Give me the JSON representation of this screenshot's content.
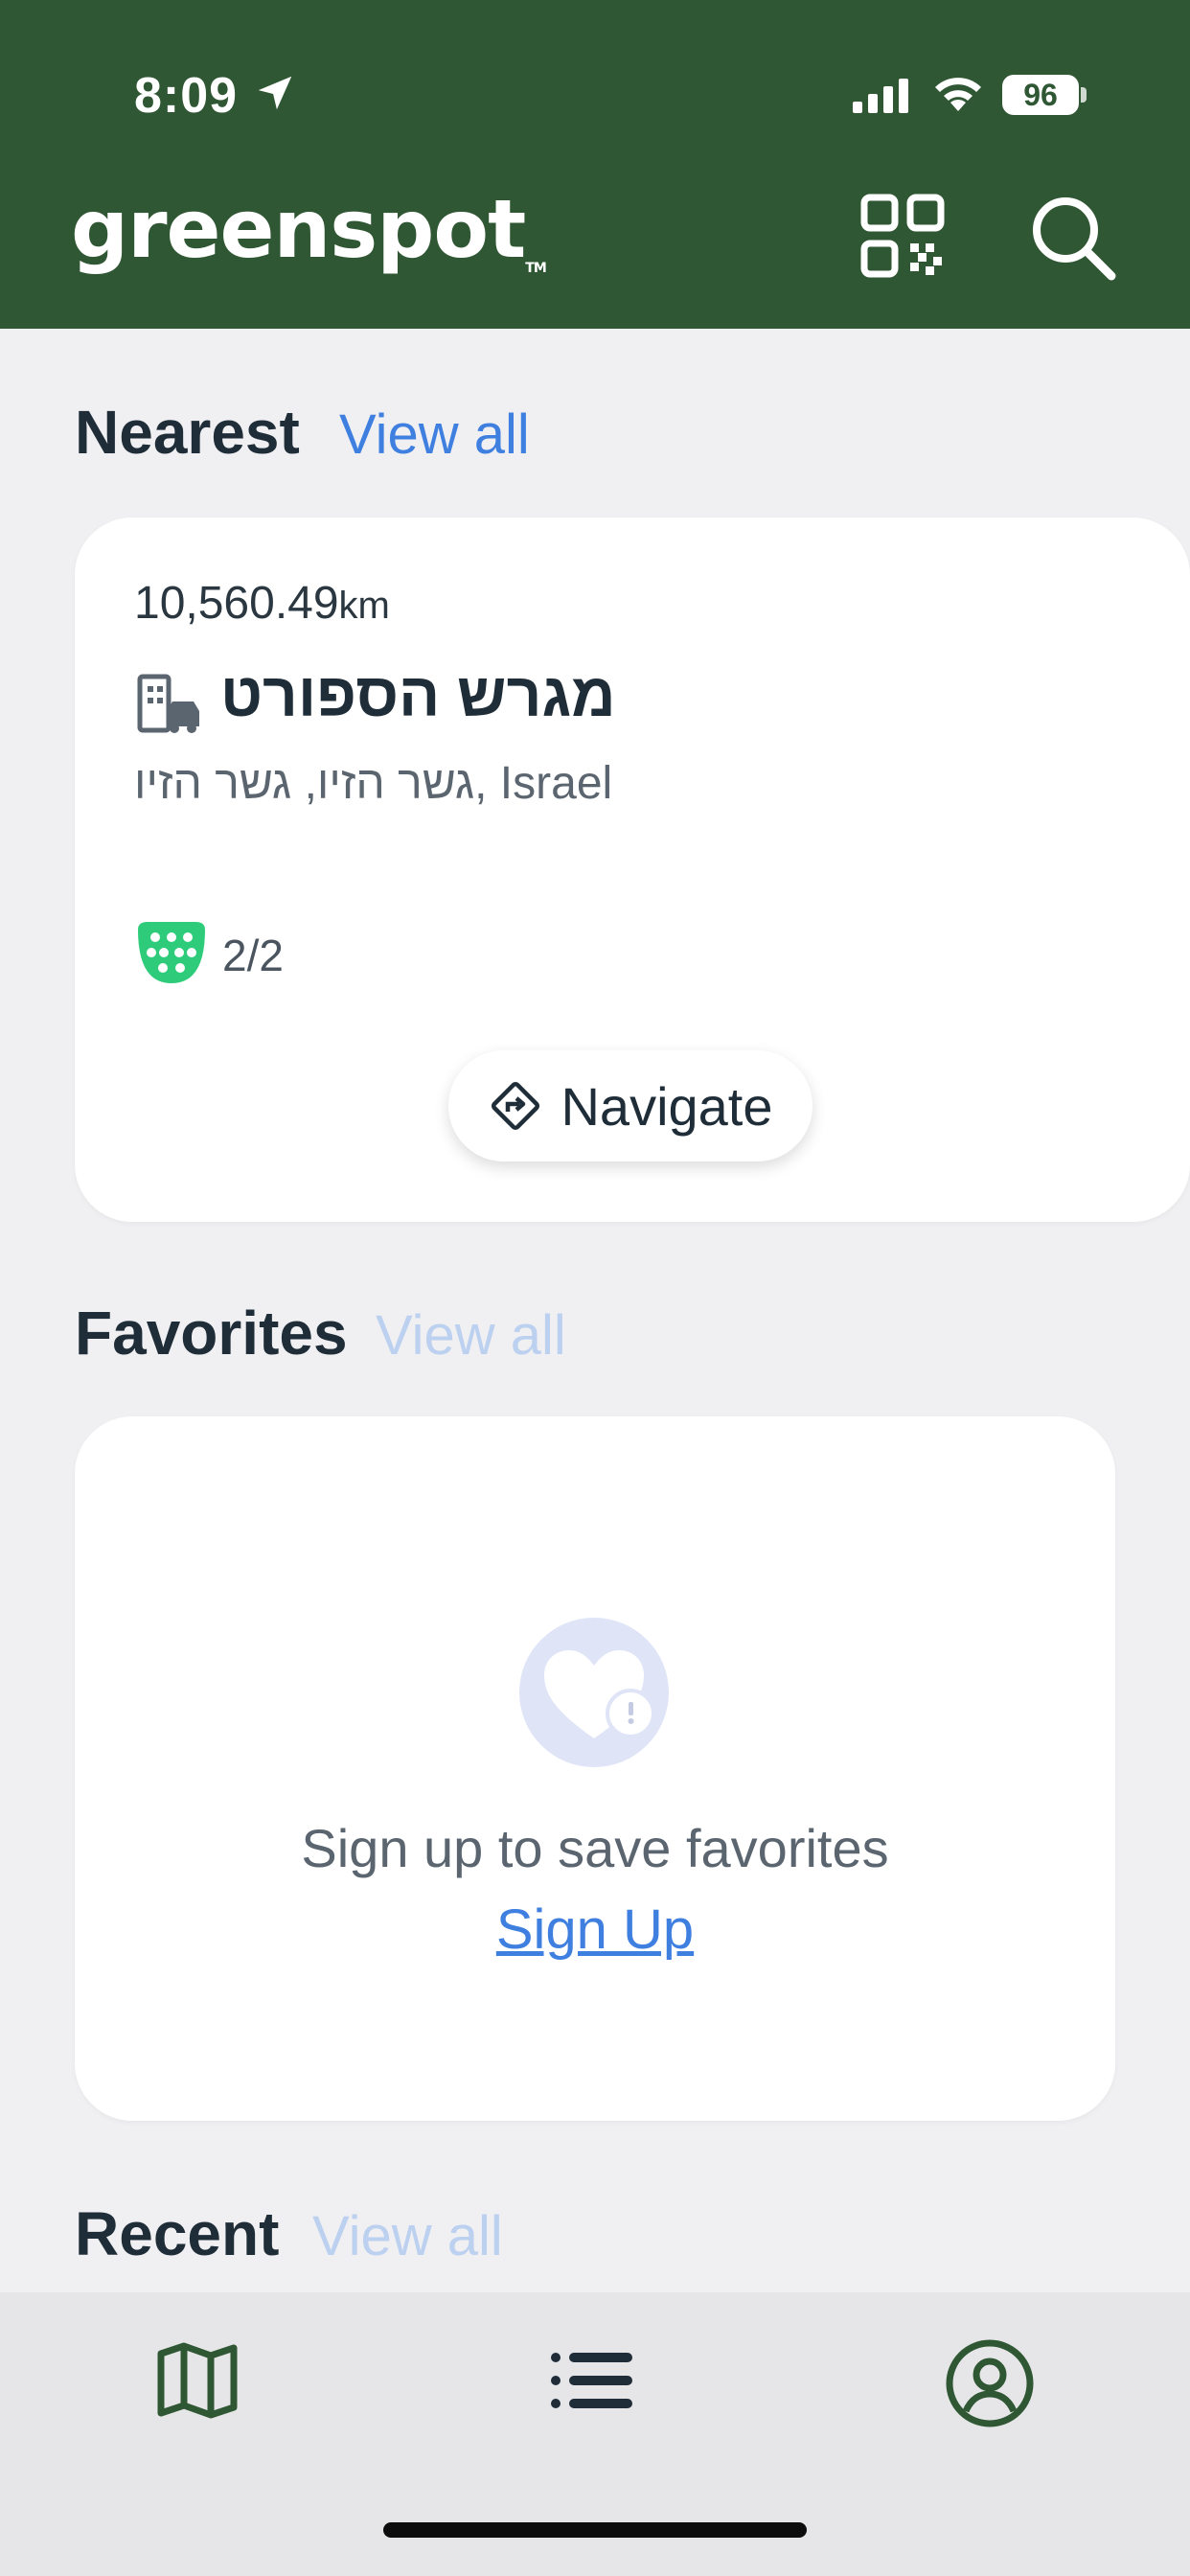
{
  "status_bar": {
    "time": "8:09",
    "battery": "96"
  },
  "header": {
    "logo": "greenspot",
    "logo_tm": "TM",
    "icons": [
      "qr-code-icon",
      "search-icon"
    ],
    "background_color": "#2f5733"
  },
  "nearest": {
    "title": "Nearest",
    "view_all": "View all",
    "station": {
      "distance": "10,560.49",
      "distance_unit": "km",
      "name": "מגרש הספורט",
      "address": "גשר הזיו, גשר הזיו, Israel",
      "availability": "2/2",
      "navigate_label": "Navigate"
    }
  },
  "favorites": {
    "title": "Favorites",
    "view_all": "View all",
    "empty_message": "Sign up to save favorites",
    "signup_label": "Sign Up"
  },
  "recent": {
    "title": "Recent",
    "view_all": "View all"
  },
  "bottom_nav": {
    "tabs": [
      "map-icon",
      "list-icon",
      "profile-icon"
    ]
  },
  "colors": {
    "accent_green": "#2f5733",
    "link_blue": "#3f7fe0",
    "connector_green": "#2ecc7a"
  }
}
